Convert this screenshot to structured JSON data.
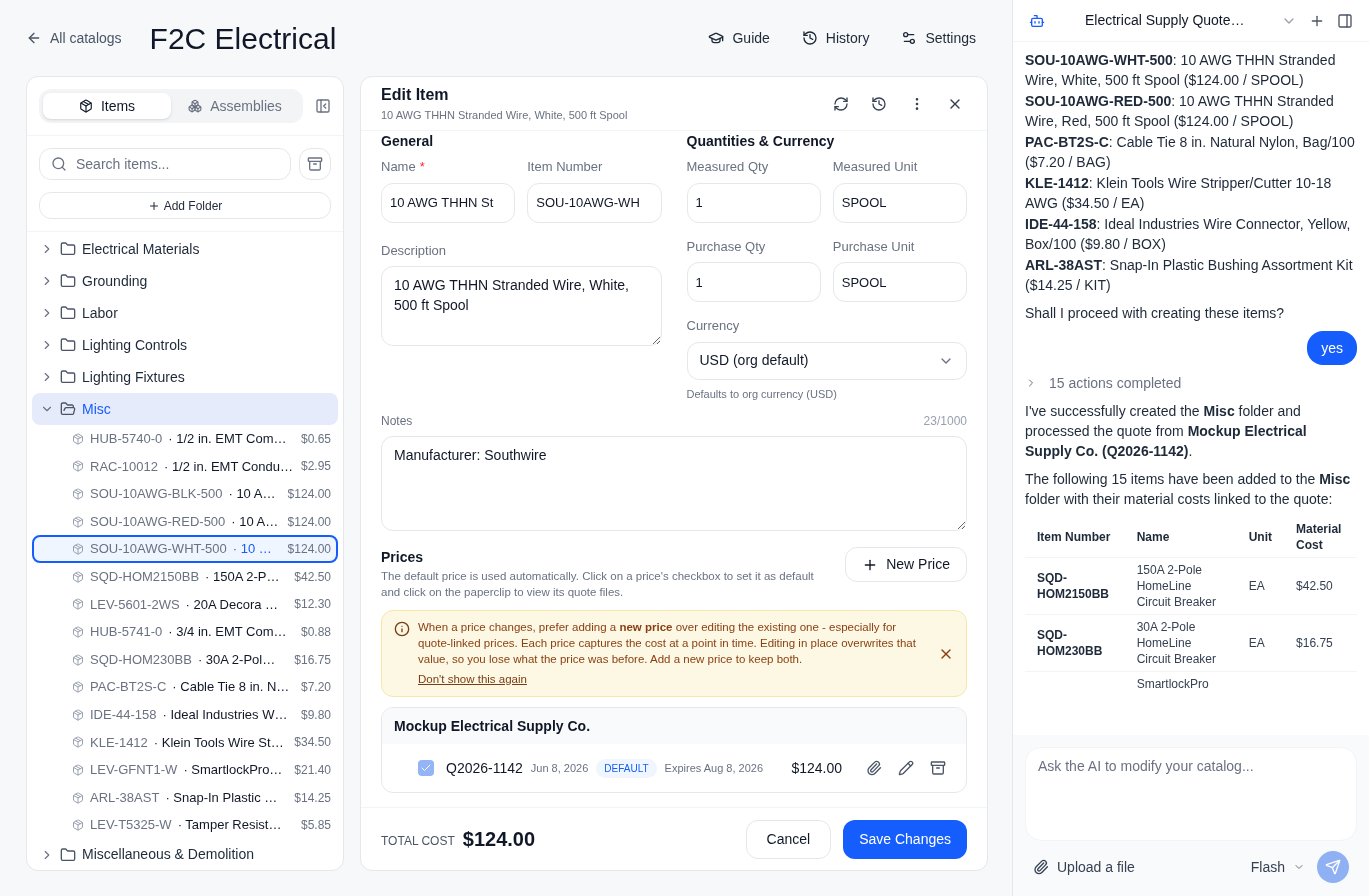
{
  "header": {
    "back_link": "All catalogs",
    "title": "F2C Electrical",
    "actions": [
      {
        "label": "Guide"
      },
      {
        "label": "History"
      },
      {
        "label": "Settings"
      }
    ]
  },
  "sidebar": {
    "tabs": [
      {
        "label": "Items",
        "selected": true
      },
      {
        "label": "Assemblies",
        "selected": false
      }
    ],
    "search": {
      "placeholder": "Search items..."
    },
    "add_folder": "Add Folder",
    "folders": [
      {
        "name": "Electrical Materials",
        "expanded": false,
        "selected": false
      },
      {
        "name": "Grounding",
        "expanded": false,
        "selected": false
      },
      {
        "name": "Labor",
        "expanded": false,
        "selected": false
      },
      {
        "name": "Lighting Controls",
        "expanded": false,
        "selected": false
      },
      {
        "name": "Lighting Fixtures",
        "expanded": false,
        "selected": false
      },
      {
        "name": "Misc",
        "expanded": true,
        "selected": true,
        "children": [
          {
            "code": "HUB-5740-0",
            "name": "· 1/2 in. EMT Com…",
            "price": "$0.65",
            "selected": false
          },
          {
            "code": "RAC-10012",
            "name": "· 1/2 in. EMT Condu…",
            "price": "$2.95",
            "selected": false
          },
          {
            "code": "SOU-10AWG-BLK-500",
            "name": "· 10 A…",
            "price": "$124.00",
            "selected": false
          },
          {
            "code": "SOU-10AWG-RED-500",
            "name": "· 10 A…",
            "price": "$124.00",
            "selected": false
          },
          {
            "code": "SOU-10AWG-WHT-500",
            "name": "· 10 …",
            "price": "$124.00",
            "selected": true
          },
          {
            "code": "SQD-HOM2150BB",
            "name": "· 150A 2-P…",
            "price": "$42.50",
            "selected": false
          },
          {
            "code": "LEV-5601-2WS",
            "name": "· 20A Decora …",
            "price": "$12.30",
            "selected": false
          },
          {
            "code": "HUB-5741-0",
            "name": "· 3/4 in. EMT Com…",
            "price": "$0.88",
            "selected": false
          },
          {
            "code": "SQD-HOM230BB",
            "name": "· 30A 2-Pol…",
            "price": "$16.75",
            "selected": false
          },
          {
            "code": "PAC-BT2S-C",
            "name": "· Cable Tie 8 in. N…",
            "price": "$7.20",
            "selected": false
          },
          {
            "code": "IDE-44-158",
            "name": "· Ideal Industries W…",
            "price": "$9.80",
            "selected": false
          },
          {
            "code": "KLE-1412",
            "name": "· Klein Tools Wire St…",
            "price": "$34.50",
            "selected": false
          },
          {
            "code": "LEV-GFNT1-W",
            "name": "· SmartlockPro…",
            "price": "$21.40",
            "selected": false
          },
          {
            "code": "ARL-38AST",
            "name": "· Snap-In Plastic …",
            "price": "$14.25",
            "selected": false
          },
          {
            "code": "LEV-T5325-W",
            "name": "· Tamper Resist…",
            "price": "$5.85",
            "selected": false
          }
        ]
      },
      {
        "name": "Miscellaneous & Demolition",
        "expanded": false,
        "selected": false
      }
    ]
  },
  "editor": {
    "title": "Edit Item",
    "subtitle": "10 AWG THHN Stranded Wire, White, 500 ft Spool",
    "general": {
      "heading": "General",
      "name": {
        "label": "Name",
        "required_mark": "*",
        "value": "10 AWG THHN St"
      },
      "item_number": {
        "label": "Item Number",
        "value": "SOU-10AWG-WH"
      },
      "description": {
        "label": "Description",
        "value": "10 AWG THHN Stranded Wire, White, 500 ft Spool"
      }
    },
    "quantities": {
      "heading": "Quantities & Currency",
      "fields": [
        {
          "label": "Measured Qty",
          "value": "1"
        },
        {
          "label": "Measured Unit",
          "value": "SPOOL"
        },
        {
          "label": "Purchase Qty",
          "value": "1"
        },
        {
          "label": "Purchase Unit",
          "value": "SPOOL"
        }
      ],
      "currency": {
        "label": "Currency",
        "value": "USD (org default)",
        "hint": "Defaults to org currency (USD)"
      }
    },
    "notes": {
      "label": "Notes",
      "counter": "23/1000",
      "value": "Manufacturer: Southwire"
    },
    "prices": {
      "heading": "Prices",
      "description": "The default price is used automatically. Click on a price's checkbox to set it as default and click on the paperclip to view its quote files.",
      "new_price": "New Price",
      "alert": {
        "text": "When a price changes, prefer adding a **new price** over editing the existing one - especially for quote-linked prices. Each price captures the cost at a point in time. Editing in place overwrites that value, so you lose what the price was before. Add a new price to keep both.",
        "link": "Don't show this again"
      },
      "suppliers": [
        {
          "name": "Mockup Electrical Supply Co.",
          "prices": [
            {
              "checked": true,
              "quote": "Q2026-1142",
              "date": "Jun 8, 2026",
              "badge": "DEFAULT",
              "expires": "Expires Aug 8, 2026",
              "amount": "$124.00"
            }
          ]
        }
      ]
    },
    "footer": {
      "total_label": "TOTAL COST",
      "total": "$124.00",
      "cancel": "Cancel",
      "save": "Save Changes"
    }
  },
  "chat": {
    "title": "Electrical Supply Quote…",
    "messages": [
      {
        "kind": "list",
        "items": [
          "**SOU-10AWG-WHT-500**: 10 AWG THHN Stranded Wire, White, 500 ft Spool ($124.00 / SPOOL)",
          "**SOU-10AWG-RED-500**: 10 AWG THHN Stranded Wire, Red, 500 ft Spool ($124.00 / SPOOL)",
          "**PAC-BT2S-C**: Cable Tie 8 in. Natural Nylon, Bag/100 ($7.20 / BAG)",
          "**KLE-1412**: Klein Tools Wire Stripper/Cutter 10-18 AWG ($34.50 / EA)",
          "**IDE-44-158**: Ideal Industries Wire Connector, Yellow, Box/100 ($9.80 / BOX)",
          "**ARL-38AST**: Snap-In Plastic Bushing Assortment Kit ($14.25 / KIT)"
        ]
      },
      {
        "kind": "text",
        "text": "Shall I proceed with creating these items?"
      },
      {
        "kind": "user",
        "text": "yes"
      },
      {
        "kind": "actions",
        "text": "15 actions completed",
        "expanded": false
      },
      {
        "kind": "text",
        "text": "I've successfully created the **Misc** folder and processed the quote from **Mockup Electrical Supply Co. (Q2026-1142)**."
      },
      {
        "kind": "text",
        "text": "The following 15 items have been added to the **Misc** folder with their material costs linked to the quote:"
      },
      {
        "kind": "table",
        "columns": [
          "Item Number",
          "Name",
          "Unit",
          "Material Cost"
        ],
        "rows": [
          [
            "SQD-HOM2150BB",
            "150A 2-Pole HomeLine Circuit Breaker",
            "EA",
            "$42.50"
          ],
          [
            "SQD-HOM230BB",
            "30A 2-Pole HomeLine Circuit Breaker",
            "EA",
            "$16.75"
          ],
          [
            "",
            "SmartlockPro",
            "",
            ""
          ]
        ]
      }
    ],
    "input": {
      "placeholder": "Ask the AI to modify your catalog..."
    },
    "upload": "Upload a file",
    "model": "Flash",
    "send_disabled": true
  }
}
